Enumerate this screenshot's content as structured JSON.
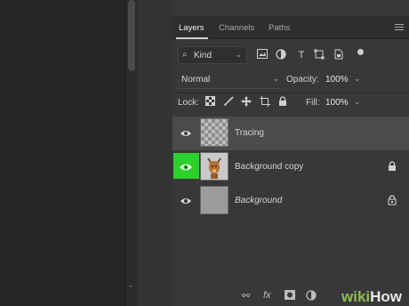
{
  "tabs": [
    "Layers",
    "Channels",
    "Paths"
  ],
  "filter": {
    "kind_label": "Kind"
  },
  "blend_mode": "Normal",
  "opacity": {
    "label": "Opacity:",
    "value": "100%"
  },
  "lock": {
    "label": "Lock:"
  },
  "fill": {
    "label": "Fill:",
    "value": "100%"
  },
  "layers": [
    {
      "name": "Tracing",
      "selected": true,
      "visible": true,
      "locked": false
    },
    {
      "name": "Background copy",
      "selected": false,
      "visible": true,
      "locked": true,
      "highlighted": true
    },
    {
      "name": "Background",
      "selected": false,
      "visible": true,
      "locked": true
    }
  ],
  "bottom_icons": [
    "link-icon",
    "fx-icon",
    "mask-icon",
    "adjustment-icon",
    "folder-icon",
    "new-layer-icon",
    "trash-icon"
  ],
  "bottom": {
    "fx": "fx"
  },
  "watermark": {
    "prefix": "wiki",
    "suffix": "How"
  },
  "colors": {
    "highlight": "#2bd02b",
    "panel": "#383838",
    "selected_row": "#4b4b4b"
  }
}
